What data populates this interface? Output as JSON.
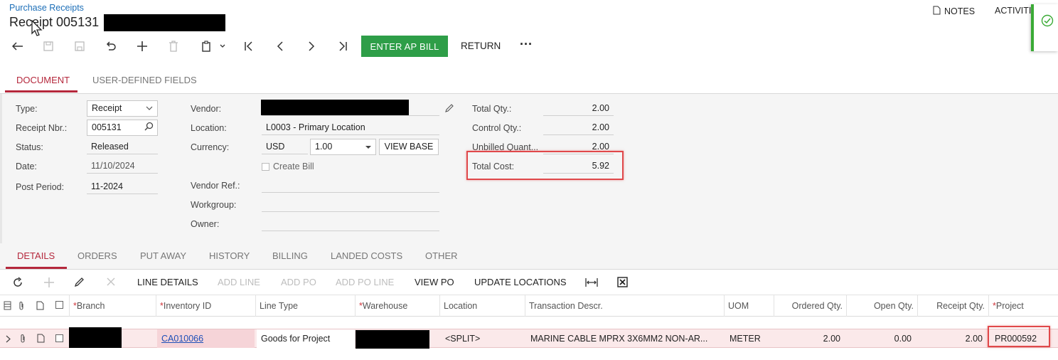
{
  "header": {
    "breadcrumb": "Purchase Receipts",
    "title": "Receipt 005131",
    "notes_label": "NOTES",
    "activities_label": "ACTIVITI"
  },
  "toolbar": {
    "enter_ap_bill": "ENTER AP BILL",
    "return": "RETURN",
    "more": "···"
  },
  "doc_tabs": [
    "DOCUMENT",
    "USER-DEFINED FIELDS"
  ],
  "form": {
    "type_label": "Type:",
    "type_value": "Receipt",
    "receipt_nbr_label": "Receipt Nbr.:",
    "receipt_nbr_value": "005131",
    "status_label": "Status:",
    "status_value": "Released",
    "date_label": "Date:",
    "date_value": "11/10/2024",
    "post_period_label": "Post Period:",
    "post_period_value": "11-2024",
    "vendor_label": "Vendor:",
    "location_label": "Location:",
    "location_value": "L0003 - Primary Location",
    "currency_label": "Currency:",
    "currency_value": "USD",
    "rate_value": "1.00",
    "view_base": "VIEW BASE",
    "create_bill_label": "Create Bill",
    "vendor_ref_label": "Vendor Ref.:",
    "workgroup_label": "Workgroup:",
    "owner_label": "Owner:",
    "total_qty_label": "Total Qty.:",
    "total_qty_value": "2.00",
    "control_qty_label": "Control Qty.:",
    "control_qty_value": "2.00",
    "unbilled_label": "Unbilled Quant...",
    "unbilled_value": "2.00",
    "total_cost_label": "Total Cost:",
    "total_cost_value": "5.92"
  },
  "detail_tabs": [
    "DETAILS",
    "ORDERS",
    "PUT AWAY",
    "HISTORY",
    "BILLING",
    "LANDED COSTS",
    "OTHER"
  ],
  "grid_toolbar": {
    "line_details": "LINE DETAILS",
    "add_line": "ADD LINE",
    "add_po": "ADD PO",
    "add_po_line": "ADD PO LINE",
    "view_po": "VIEW PO",
    "update_locations": "UPDATE LOCATIONS"
  },
  "grid": {
    "columns": [
      "Branch",
      "Inventory ID",
      "Line Type",
      "Warehouse",
      "Location",
      "Transaction Descr.",
      "UOM",
      "Ordered Qty.",
      "Open Qty.",
      "Receipt Qty.",
      "Project"
    ],
    "rows": [
      {
        "inventory_id": "CA010066",
        "line_type": "Goods for Project",
        "location": "<SPLIT>",
        "description": "MARINE CABLE MPRX 3X6MM2 NON-AR...",
        "uom": "METER",
        "ordered_qty": "2.00",
        "open_qty": "0.00",
        "receipt_qty": "2.00",
        "project": "PR000592"
      }
    ]
  },
  "colors": {
    "accent": "#b5283c",
    "primary_button": "#2e9e48",
    "link": "#1d4fb8",
    "highlight": "#e0484a"
  }
}
